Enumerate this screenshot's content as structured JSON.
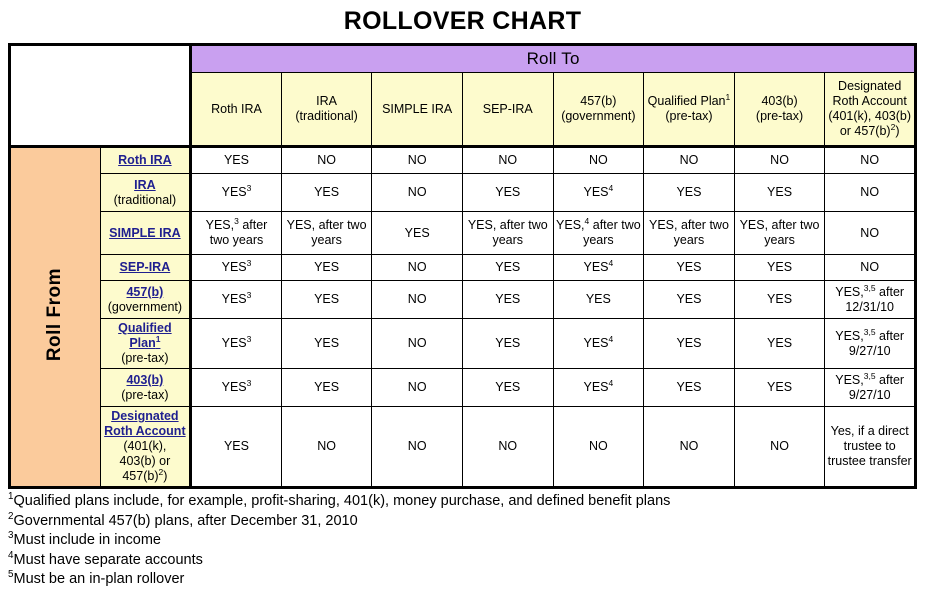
{
  "title": "ROLLOVER CHART",
  "axis": {
    "roll_to": "Roll To",
    "roll_from": "Roll From"
  },
  "colors": {
    "roll_to_banner": "#c9a0f0",
    "header_cell": "#fdfbcd",
    "roll_from_band": "#fbcb9c",
    "link_text": "#1f1f8f",
    "cell_bg": "#ffffff",
    "border": "#000000"
  },
  "columns": [
    {
      "name": "Roth IRA",
      "sub": "",
      "sup": "",
      "inline_sub": ""
    },
    {
      "name": "IRA",
      "sub": "(traditional)",
      "sup": "",
      "inline_sub": ""
    },
    {
      "name": "SIMPLE IRA",
      "sub": "",
      "sup": "",
      "inline_sub": ""
    },
    {
      "name": "SEP-IRA",
      "sub": "",
      "sup": "",
      "inline_sub": ""
    },
    {
      "name": "457(b)",
      "sub": "(government)",
      "sup": "",
      "inline_sub": ""
    },
    {
      "name": "Qualified Plan",
      "sub": "(pre-tax)",
      "sup": "1",
      "inline_sub": ""
    },
    {
      "name": "403(b)",
      "sub": "(pre-tax)",
      "sup": "",
      "inline_sub": ""
    },
    {
      "name": "Designated Roth Account",
      "sub": "(401(k), 403(b) or 457(b)",
      "sup": "",
      "inline_sub": "2)"
    }
  ],
  "rows": [
    {
      "header": "Roth IRA",
      "header_sub": "",
      "header_sup": "",
      "cells": [
        "YES",
        "NO",
        "NO",
        "NO",
        "NO",
        "NO",
        "NO",
        "NO"
      ]
    },
    {
      "header": "IRA",
      "header_sub": "(traditional)",
      "header_sup": "",
      "cells": [
        "YES3",
        "YES",
        "NO",
        "YES",
        "YES4",
        "YES",
        "YES",
        "NO"
      ]
    },
    {
      "header": "SIMPLE IRA",
      "header_sub": "",
      "header_sup": "",
      "cells": [
        "YES,3 after two years",
        "YES, after two years",
        "YES",
        "YES, after two years",
        "YES,4 after two years",
        "YES, after two years",
        "YES, after two years",
        "NO"
      ]
    },
    {
      "header": "SEP-IRA",
      "header_sub": "",
      "header_sup": "",
      "cells": [
        "YES3",
        "YES",
        "NO",
        "YES",
        "YES4",
        "YES",
        "YES",
        "NO"
      ]
    },
    {
      "header": "457(b)",
      "header_sub": "(government)",
      "header_sup": "",
      "cells": [
        "YES3",
        "YES",
        "NO",
        "YES",
        "YES",
        "YES",
        "YES",
        "YES,35 after 12/31/10"
      ]
    },
    {
      "header": "Qualified Plan",
      "header_sub": "(pre-tax)",
      "header_sup": "1",
      "cells": [
        "YES3",
        "YES",
        "NO",
        "YES",
        "YES4",
        "YES",
        "YES",
        "YES,35 after 9/27/10"
      ]
    },
    {
      "header": "403(b)",
      "header_sub": "(pre-tax)",
      "header_sup": "",
      "cells": [
        "YES3",
        "YES",
        "NO",
        "YES",
        "YES4",
        "YES",
        "YES",
        "YES,35 after 9/27/10"
      ]
    },
    {
      "header": "Designated Roth Account",
      "header_sub": "(401(k), 403(b) or 457(b)2)",
      "header_sup": "",
      "cells": [
        "YES",
        "NO",
        "NO",
        "NO",
        "NO",
        "NO",
        "NO",
        "Yes, if a direct trustee to trustee transfer"
      ]
    }
  ],
  "footnotes": [
    {
      "marker": "1",
      "text": "Qualified plans include, for example, profit-sharing, 401(k), money purchase, and defined benefit plans"
    },
    {
      "marker": "2",
      "text": "Governmental 457(b) plans, after December 31, 2010"
    },
    {
      "marker": "3",
      "text": "Must include in income"
    },
    {
      "marker": "4",
      "text": "Must have separate accounts"
    },
    {
      "marker": "5",
      "text": "Must be an in-plan rollover"
    }
  ]
}
